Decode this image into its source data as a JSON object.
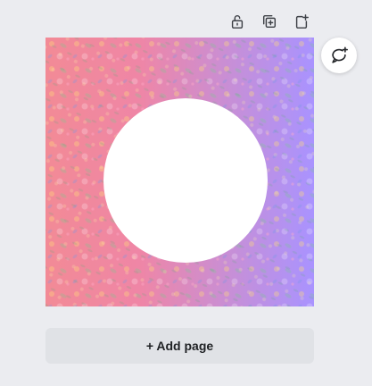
{
  "toolbar": {
    "icons": [
      "unlock-icon",
      "duplicate-page-icon",
      "add-page-icon"
    ]
  },
  "comment_button": {
    "icon": "add-comment-icon"
  },
  "canvas": {
    "background_colors": [
      "#f28a96",
      "#ef86a6",
      "#c68fd8",
      "#a993ff"
    ],
    "circle_color": "#ffffff"
  },
  "add_page": {
    "label": "+ Add page"
  }
}
